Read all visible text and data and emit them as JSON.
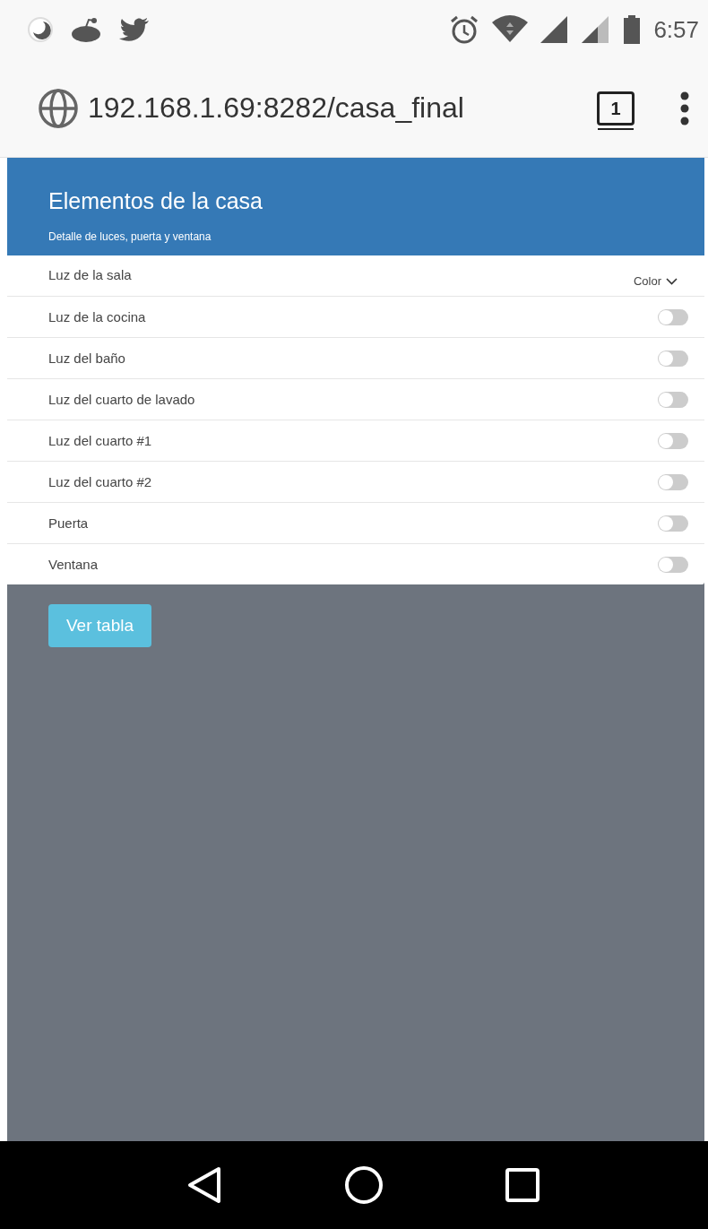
{
  "status_bar": {
    "time": "6:57"
  },
  "browser": {
    "url": "192.168.1.69:8282/casa_final",
    "tab_count": "1"
  },
  "header": {
    "title": "Elementos de la casa",
    "subtitle": "Detalle de luces, puerta y ventana"
  },
  "items": [
    {
      "kind": "dropdown",
      "label": "Luz de la sala",
      "control_label": "Color"
    },
    {
      "kind": "toggle",
      "label": "Luz de la cocina",
      "on": false
    },
    {
      "kind": "toggle",
      "label": "Luz del baño",
      "on": false
    },
    {
      "kind": "toggle",
      "label": "Luz del cuarto de lavado",
      "on": false
    },
    {
      "kind": "toggle",
      "label": "Luz del cuarto #1",
      "on": false
    },
    {
      "kind": "toggle",
      "label": "Luz del cuarto #2",
      "on": false
    },
    {
      "kind": "toggle",
      "label": "Puerta",
      "on": false
    },
    {
      "kind": "toggle",
      "label": "Ventana",
      "on": false
    }
  ],
  "button": {
    "label": "Ver tabla"
  }
}
